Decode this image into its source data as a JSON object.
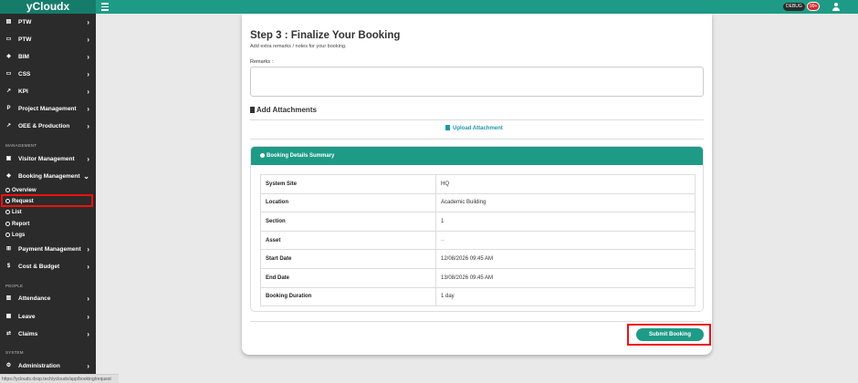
{
  "app": {
    "brand": "yCloudx",
    "debug": "DEBUG",
    "notifications": "99+"
  },
  "colors": {
    "accent": "#1e9b86",
    "sidebar": "#2b2b2b",
    "highlight": "#e11111",
    "link": "#2196b0"
  },
  "sidebar": {
    "items": [
      {
        "label": "PTW",
        "icon": "file-icon"
      },
      {
        "label": "PTW",
        "icon": "card-icon"
      },
      {
        "label": "BIM",
        "icon": "cube-icon"
      },
      {
        "label": "CSS",
        "icon": "monitor-icon"
      },
      {
        "label": "KPI",
        "icon": "chart-icon"
      },
      {
        "label": "Project Management",
        "icon": "project-icon"
      },
      {
        "label": "OEE & Production",
        "icon": "chart-icon"
      }
    ],
    "section_management": "MANAGEMENT",
    "visitor": {
      "label": "Visitor Management",
      "icon": "id-card-icon"
    },
    "booking": {
      "label": "Booking Management",
      "icon": "diamond-icon"
    },
    "booking_sub": [
      "Overview",
      "Request",
      "List",
      "Report",
      "Logs"
    ],
    "payment": {
      "label": "Payment Management",
      "icon": "cart-icon"
    },
    "cost": {
      "label": "Cost & Budget",
      "icon": "dollar-icon"
    },
    "section_people": "PEOPLE",
    "attendance": {
      "label": "Attendance",
      "icon": "book-icon"
    },
    "leave": {
      "label": "Leave",
      "icon": "calendar-icon"
    },
    "claims": {
      "label": "Claims",
      "icon": "transfer-icon"
    },
    "section_system": "SYSTEM",
    "administration": {
      "label": "Administration",
      "icon": "user-cog-icon"
    }
  },
  "status_url": "https://ycloudx.dxsp.tech/ycloudx/app/booking/request",
  "form": {
    "step_title": "Step 3 : Finalize Your Booking",
    "step_subtitle": "Add extra remarks / notes for your booking.",
    "remarks_label": "Remarks :",
    "remarks_value": "",
    "attachments_title": "Add Attachments",
    "upload_label": "Upload Attachment",
    "summary_title": "Booking Details Summary",
    "summary_rows": [
      {
        "key": "System Site",
        "value": "HQ"
      },
      {
        "key": "Location",
        "value": "Academic Building"
      },
      {
        "key": "Section",
        "value": "1"
      },
      {
        "key": "Asset",
        "value": "--"
      },
      {
        "key": "Start Date",
        "value": "12/08/2026 09:45 AM"
      },
      {
        "key": "End Date",
        "value": "13/08/2026 09:45 AM"
      },
      {
        "key": "Booking Duration",
        "value": "1 day"
      }
    ],
    "submit_label": "Submit Booking"
  }
}
